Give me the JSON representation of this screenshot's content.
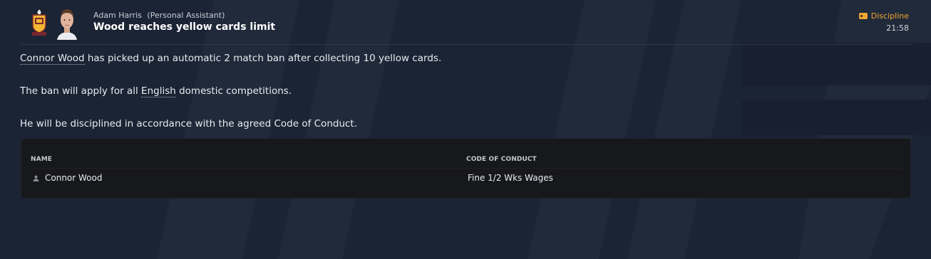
{
  "header": {
    "sender_name": "Adam Harris",
    "sender_role": "(Personal Assistant)",
    "subject": "Wood reaches yellow cards limit",
    "category": "Discipline",
    "time": "21:58"
  },
  "body": {
    "p1_link": "Connor Wood",
    "p1_rest": " has picked up an automatic 2 match ban after collecting 10 yellow cards.",
    "p2_pre": "The ban will apply for all ",
    "p2_link": "English",
    "p2_post": " domestic competitions.",
    "p3": "He will be disciplined in accordance with the agreed Code of Conduct."
  },
  "table": {
    "headers": [
      "NAME",
      "CODE OF CONDUCT"
    ],
    "rows": [
      {
        "name": "Connor Wood",
        "conduct": "Fine 1/2 Wks Wages"
      }
    ]
  },
  "colors": {
    "background": "#1b2434",
    "accent": "#f0a531",
    "table_bg": "#16181c"
  },
  "icons": [
    "club-badge-icon",
    "staff-avatar",
    "discipline-card-icon",
    "person-icon"
  ]
}
